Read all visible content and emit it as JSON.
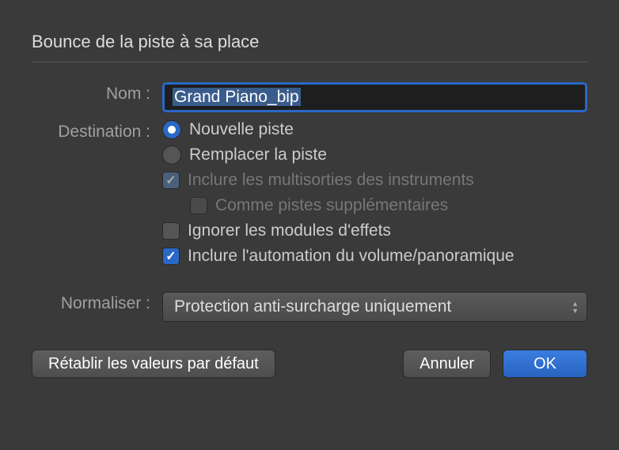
{
  "title": "Bounce de la piste à sa place",
  "name": {
    "label": "Nom :",
    "value": "Grand Piano_bip"
  },
  "destination": {
    "label": "Destination :",
    "options": {
      "new_track": "Nouvelle piste",
      "replace_track": "Remplacer la piste"
    },
    "include_multioutput": "Inclure les multisorties des instruments",
    "as_additional_tracks": "Comme pistes supplémentaires",
    "bypass_effects": "Ignorer les modules d'effets",
    "include_automation": "Inclure l'automation du volume/panoramique"
  },
  "normalize": {
    "label": "Normaliser :",
    "selected": "Protection anti-surcharge uniquement"
  },
  "buttons": {
    "reset": "Rétablir les valeurs par défaut",
    "cancel": "Annuler",
    "ok": "OK"
  }
}
